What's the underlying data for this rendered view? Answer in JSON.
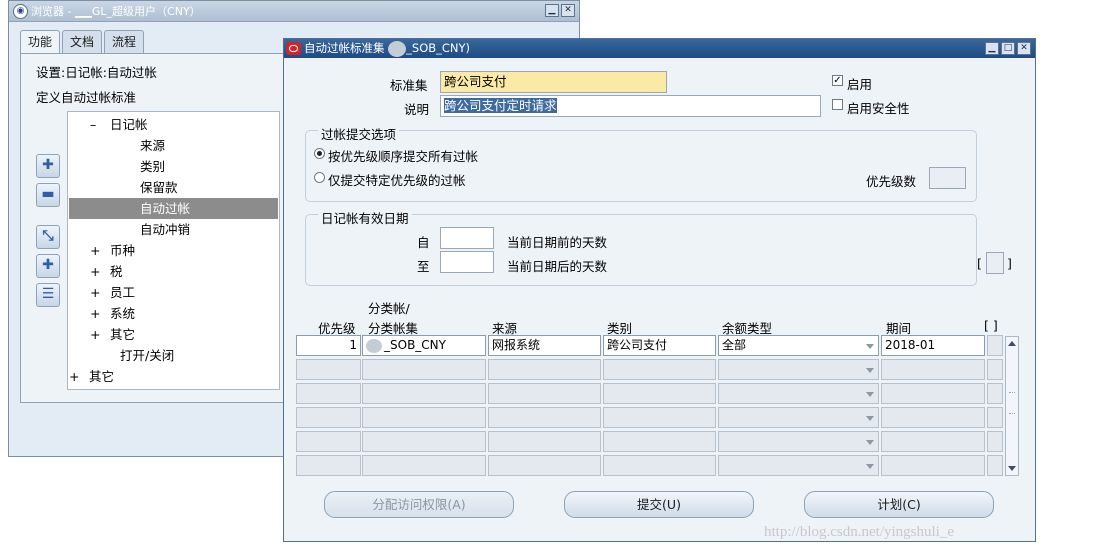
{
  "navigator": {
    "title": "浏览器 - ▁▁GL_超级用户（CNY）",
    "tabs": [
      "功能",
      "文档",
      "流程"
    ],
    "setting_line": "设置:日记帐:自动过帐",
    "define_line": "定义自动过帐标准",
    "tree": [
      {
        "expander": "–",
        "label": "日记帐"
      },
      {
        "expander": "",
        "label": "来源"
      },
      {
        "expander": "",
        "label": "类别"
      },
      {
        "expander": "",
        "label": "保留款"
      },
      {
        "expander": "",
        "label": "自动过帐",
        "selected": true
      },
      {
        "expander": "",
        "label": "自动冲销"
      },
      {
        "expander": "+",
        "label": "币种"
      },
      {
        "expander": "+",
        "label": "税"
      },
      {
        "expander": "+",
        "label": "员工"
      },
      {
        "expander": "+",
        "label": "系统"
      },
      {
        "expander": "+",
        "label": "其它"
      },
      {
        "expander": "",
        "label": "打开/关闭"
      },
      {
        "expander": "+",
        "label": "其它"
      }
    ],
    "side_buttons": [
      "plus-icon",
      "minus-icon",
      "expand-branch-icon",
      "expand-all-icon",
      "collapse-all-icon"
    ]
  },
  "dialog": {
    "title": "自动过帐标准集",
    "title_suffix": "_SOB_CNY)",
    "criteria_set_label": "标准集",
    "criteria_set_value": "跨公司支付",
    "description_label": "说明",
    "description_value": "跨公司支付定时请求",
    "enabled_label": "启用",
    "enabled_checked": true,
    "security_label": "启用安全性",
    "security_checked": false,
    "posting_options": {
      "title": "过帐提交选项",
      "option_all": "按优先级顺序提交所有过帐",
      "option_specific": "仅提交特定优先级的过帐",
      "priority_label": "优先级数",
      "priority_value": ""
    },
    "effective_date": {
      "title": "日记帐有效日期",
      "from_label": "自",
      "to_label": "至",
      "from_value": "",
      "to_value": "",
      "before_text": "当前日期前的天数",
      "after_text": "当前日期后的天数",
      "bracket": "[",
      "bracket_close": "]"
    },
    "table": {
      "headers": {
        "priority": "优先级",
        "ledger_top": "分类帐/",
        "ledger": "分类帐集",
        "source": "来源",
        "category": "类别",
        "balance_type": "余额类型",
        "period": "期间",
        "bracket": "[ ]"
      },
      "first_row": {
        "priority": "1",
        "ledger": "_SOB_CNY",
        "source": "网报系统",
        "category": "跨公司支付",
        "balance_type": "全部",
        "period": "2018-01"
      }
    },
    "buttons": {
      "assign_access": "分配访问权限(A)",
      "submit": "提交(U)",
      "schedule": "计划(C)"
    }
  },
  "watermark": "http://blog.csdn.net/yingshuli_e"
}
